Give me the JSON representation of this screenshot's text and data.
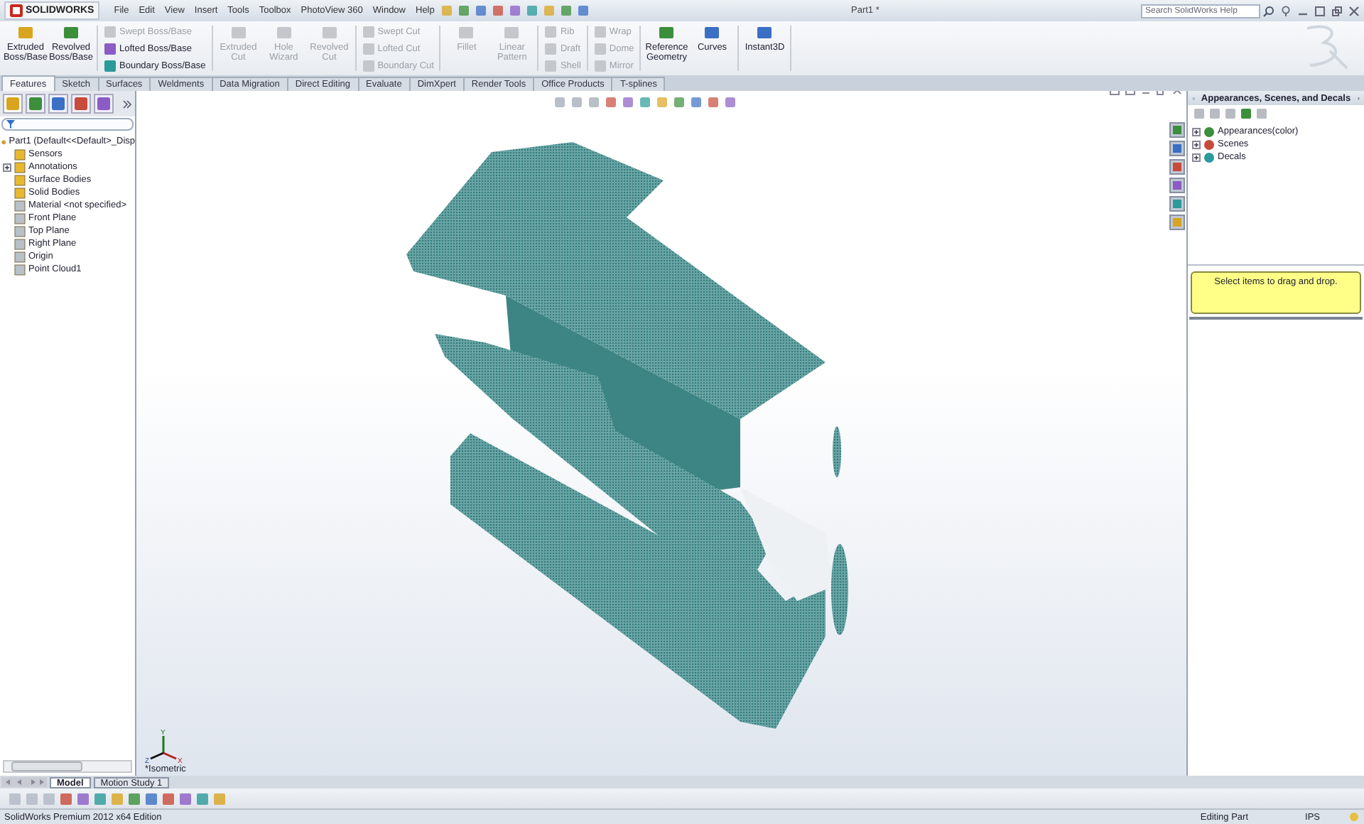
{
  "title_bar": {
    "logo": "SOLIDWORKS",
    "menus": [
      "File",
      "Edit",
      "View",
      "Insert",
      "Tools",
      "Toolbox",
      "PhotoView 360",
      "Window",
      "Help"
    ],
    "document_title": "Part1 *",
    "search": {
      "placeholder": "Search SolidWorks Help"
    }
  },
  "ribbon": {
    "groups": [
      {
        "kind": "large",
        "items": [
          {
            "label": "Extruded Boss/Base",
            "disabled": false
          },
          {
            "label": "Revolved Boss/Base",
            "disabled": false
          }
        ]
      },
      {
        "kind": "stack",
        "items": [
          {
            "label": "Swept Boss/Base",
            "disabled": true
          },
          {
            "label": "Lofted Boss/Base",
            "disabled": false
          },
          {
            "label": "Boundary Boss/Base",
            "disabled": false
          }
        ]
      },
      {
        "kind": "large",
        "items": [
          {
            "label": "Extruded Cut",
            "disabled": true
          },
          {
            "label": "Hole Wizard",
            "disabled": true
          },
          {
            "label": "Revolved Cut",
            "disabled": true
          }
        ]
      },
      {
        "kind": "stack",
        "items": [
          {
            "label": "Swept Cut",
            "disabled": true
          },
          {
            "label": "Lofted Cut",
            "disabled": true
          },
          {
            "label": "Boundary Cut",
            "disabled": true
          }
        ]
      },
      {
        "kind": "large",
        "items": [
          {
            "label": "Fillet",
            "disabled": true
          },
          {
            "label": "Linear Pattern",
            "disabled": true
          }
        ]
      },
      {
        "kind": "stack",
        "items": [
          {
            "label": "Rib",
            "disabled": true
          },
          {
            "label": "Draft",
            "disabled": true
          },
          {
            "label": "Shell",
            "disabled": true
          }
        ]
      },
      {
        "kind": "stack",
        "items": [
          {
            "label": "Wrap",
            "disabled": true
          },
          {
            "label": "Dome",
            "disabled": true
          },
          {
            "label": "Mirror",
            "disabled": true
          }
        ]
      },
      {
        "kind": "large",
        "items": [
          {
            "label": "Reference Geometry",
            "disabled": false
          },
          {
            "label": "Curves",
            "disabled": false
          }
        ]
      },
      {
        "kind": "large",
        "items": [
          {
            "label": "Instant3D",
            "disabled": false
          }
        ]
      }
    ]
  },
  "tabs": [
    {
      "label": "Features",
      "selected": true
    },
    {
      "label": "Sketch",
      "selected": false
    },
    {
      "label": "Surfaces",
      "selected": false
    },
    {
      "label": "Weldments",
      "selected": false
    },
    {
      "label": "Data Migration",
      "selected": false
    },
    {
      "label": "Direct Editing",
      "selected": false
    },
    {
      "label": "Evaluate",
      "selected": false
    },
    {
      "label": "DimXpert",
      "selected": false
    },
    {
      "label": "Render Tools",
      "selected": false
    },
    {
      "label": "Office Products",
      "selected": false
    },
    {
      "label": "T-splines",
      "selected": false
    }
  ],
  "feature_tree": {
    "root": "Part1  (Default<<Default>_Disp",
    "children": [
      {
        "label": "Sensors",
        "expandable": false
      },
      {
        "label": "Annotations",
        "expandable": true
      },
      {
        "label": "Surface Bodies",
        "expandable": false
      },
      {
        "label": "Solid Bodies",
        "expandable": false
      },
      {
        "label": "Material <not specified>",
        "expandable": false
      },
      {
        "label": "Front Plane",
        "expandable": false
      },
      {
        "label": "Top Plane",
        "expandable": false
      },
      {
        "label": "Right Plane",
        "expandable": false
      },
      {
        "label": "Origin",
        "expandable": false
      },
      {
        "label": "Point Cloud1",
        "expandable": false
      }
    ]
  },
  "viewport": {
    "view_name": "*Isometric",
    "triad": {
      "x": "X",
      "y": "Y",
      "z": "Z"
    }
  },
  "task_pane": {
    "title": "Appearances, Scenes, and Decals",
    "items": [
      {
        "label": "Appearances(color)",
        "expandable": true
      },
      {
        "label": "Scenes",
        "expandable": true
      },
      {
        "label": "Decals",
        "expandable": true
      }
    ],
    "hint": "Select items to drag and drop."
  },
  "bottom_tabs": [
    {
      "label": "Model",
      "selected": true
    },
    {
      "label": "Motion Study 1",
      "selected": false
    }
  ],
  "status_bar": {
    "product": "SolidWorks Premium 2012 x64 Edition",
    "mode": "Editing Part",
    "units": "IPS"
  }
}
